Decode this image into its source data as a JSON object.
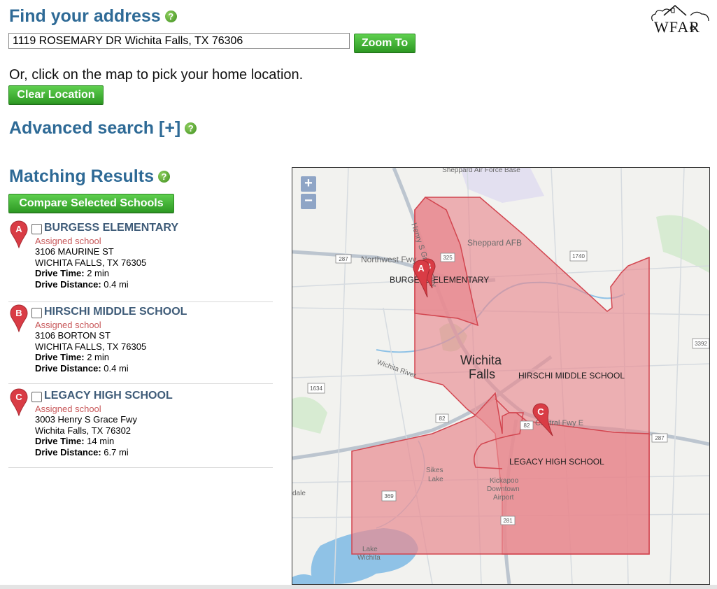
{
  "header": {
    "find_title": "Find your address",
    "help_glyph": "?",
    "address_value": "1119 ROSEMARY DR Wichita Falls, TX 76306",
    "zoom_label": "Zoom To",
    "click_hint": "Or, click on the map to pick your home location.",
    "clear_label": "Clear Location",
    "advanced_title": "Advanced search [+]",
    "logo_text": "WFAR"
  },
  "results": {
    "title": "Matching Results",
    "compare_label": "Compare Selected Schools",
    "items": [
      {
        "letter": "A",
        "name": "BURGESS ELEMENTARY",
        "assigned": "Assigned school",
        "street": "3106 MAURINE ST",
        "city": "WICHITA FALLS, TX 76305",
        "drive_time_label": "Drive Time:",
        "drive_time": "2 min",
        "drive_dist_label": "Drive Distance:",
        "drive_dist": "0.4 mi"
      },
      {
        "letter": "B",
        "name": "HIRSCHI MIDDLE SCHOOL",
        "assigned": "Assigned school",
        "street": "3106 BORTON ST",
        "city": "WICHITA FALLS, TX 76305",
        "drive_time_label": "Drive Time:",
        "drive_time": "2 min",
        "drive_dist_label": "Drive Distance:",
        "drive_dist": "0.4 mi"
      },
      {
        "letter": "C",
        "name": "LEGACY HIGH SCHOOL",
        "assigned": "Assigned school",
        "street": "3003 Henry S Grace Fwy",
        "city": "Wichita Falls, TX 76302",
        "drive_time_label": "Drive Time:",
        "drive_time": "14 min",
        "drive_dist_label": "Drive Distance:",
        "drive_dist": "6.7 mi"
      }
    ]
  },
  "map": {
    "zoom_in": "+",
    "zoom_out": "−",
    "labels": {
      "sheppard_base": "Sheppard Air Force Base",
      "henry_grace": "Henry S Grace Fwy",
      "northwest_fwy": "Northwest Fwy",
      "sheppard_afb": "Sheppard AFB",
      "wichita": "Wichita",
      "falls": "Falls",
      "wichita_river": "Wichita River",
      "central_fwy": "Central Fwy E",
      "sikes": "Sikes",
      "lake": "Lake",
      "kickapoo": "Kickapoo",
      "downtown": "Downtown",
      "airport": "Airport",
      "lake_wichita_1": "Lake",
      "lake_wichita_2": "Wichita",
      "dale": "dale",
      "burgess": "BURGESS ELEMENTARY",
      "hirschi": "HIRSCHI MIDDLE SCHOOL",
      "legacy": "LEGACY HIGH SCHOOL",
      "pin_a": "A",
      "pin_b": "B",
      "pin_c": "C"
    },
    "shields": {
      "s287a": "287",
      "s325": "325",
      "s1740": "1740",
      "s3392": "3392",
      "s1634": "1634",
      "s82a": "82",
      "s82b": "82",
      "s287b": "287",
      "s369": "369",
      "s281": "281"
    },
    "zone_color": "#e88a90",
    "zone_border": "#d2454f"
  }
}
